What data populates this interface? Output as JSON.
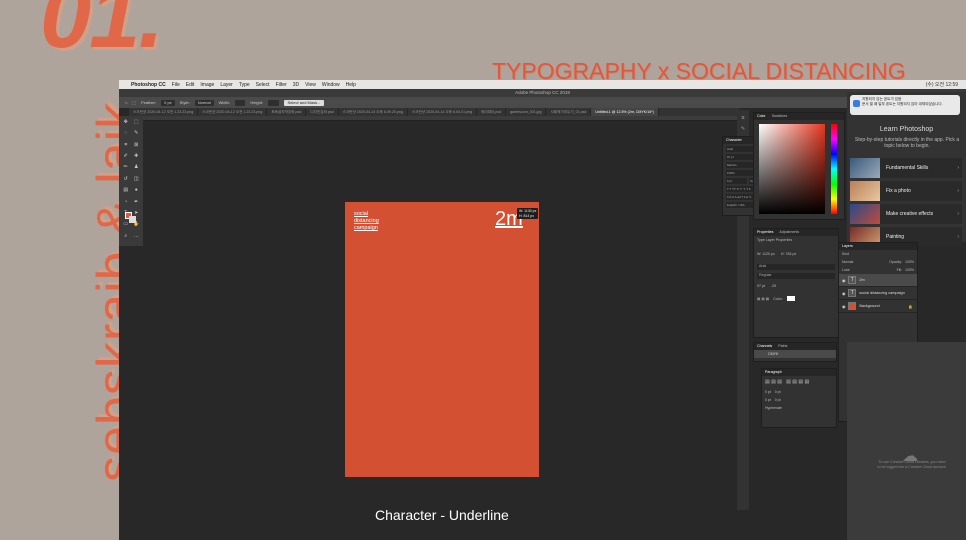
{
  "slide": {
    "number": "01.",
    "headline": "TYPOGRAPHY x SOCIAL DISTANCING",
    "vertical_text": "sebskraib & laik",
    "caption": "Character - Underline",
    "accent_color": "#e2573a"
  },
  "menubar": {
    "app_name": "Photoshop CC",
    "items": [
      "File",
      "Edit",
      "Image",
      "Layer",
      "Type",
      "Select",
      "Filter",
      "3D",
      "View",
      "Window",
      "Help"
    ],
    "clock": "(수) 오전 12:59"
  },
  "window_title": "Adobe Photoshop CC 2019",
  "options_bar": {
    "feather_label": "Feather:",
    "feather_value": "0 px",
    "style_label": "Style:",
    "style_value": "Normal",
    "width_label": "Width:",
    "height_label": "Height:",
    "select_mask_label": "Select and Mask..."
  },
  "tabs": [
    "스크린샷 2020-04-12 오전 1.23.23.png",
    "스크린샷 2020-04-12 오전 1.23.23.png",
    "포토샵자막강좌.psd",
    "디자인강좌.psd",
    "스크린샷 2020-04-14 오후 6.09.20.png",
    "스크린샷 2020-04-14 오후 6.04.01.png",
    "와이파이.psd",
    "gamescom_001.jpg",
    "사회적거리두기_01.psd",
    "Untitled-1 @ 12.5% (2m, CMYK/16*)"
  ],
  "canvas": {
    "lines": [
      "social",
      "distancing",
      "campaign"
    ],
    "big_text": "2m",
    "tooltip_w": "W: 1130 px",
    "tooltip_h": "H: 814 px",
    "color": "#d45033"
  },
  "character_panel": {
    "title": "Character",
    "font_family": "Arial",
    "font_style": "Regular",
    "size": "97 pt",
    "leading": "(Auto)",
    "tracking": "-25",
    "vertical_scale": "100%",
    "horizontal_scale": "100%",
    "baseline": "0 pt",
    "color_label": "Color:",
    "language": "English: USA",
    "antialias": "Smooth"
  },
  "color_panel": {
    "tabs": [
      "Color",
      "Swatches"
    ]
  },
  "learn_panel": {
    "notification_title": "지원되지 않는 폰트가 있음",
    "notification_body": "문서 열 때 일부 폰트는 지원되지 않아 대체되었습니다.",
    "notification_time": "오전 1",
    "title": "Learn Photoshop",
    "subtitle": "Step-by-step tutorials directly in the app. Pick a topic below to begin.",
    "cards": [
      "Fundamental Skills",
      "Fix a photo",
      "Make creative effects",
      "Painting"
    ]
  },
  "properties_panel": {
    "tabs": [
      "Properties",
      "Adjustments"
    ],
    "section": "Type Layer Properties",
    "w": "W: 1120 px",
    "h": "H: 784 px",
    "font": "Arial",
    "style": "Regular",
    "size": "97 pt",
    "tracking": "-25",
    "color_label": "Color:"
  },
  "layers_panel": {
    "title": "Layers",
    "kind": "Kind",
    "blend": "Normal",
    "opacity_label": "Opacity:",
    "opacity": "100%",
    "fill_label": "Fill:",
    "fill": "100%",
    "lock_label": "Lock:",
    "layers": [
      {
        "name": "2m",
        "thumb": "T"
      },
      {
        "name": "social distancing campaign",
        "thumb": "T"
      },
      {
        "name": "Background",
        "thumb": ""
      }
    ]
  },
  "channels_panel": {
    "tabs": [
      "Channels",
      "Paths"
    ],
    "channel": "CMYK"
  },
  "paragraph_panel": {
    "title": "Paragraph",
    "hyphenate": "Hyphenate"
  },
  "creative_cloud": {
    "message": "To use Creative Cloud Libraries, you need to be logged into a Creative Cloud account."
  }
}
